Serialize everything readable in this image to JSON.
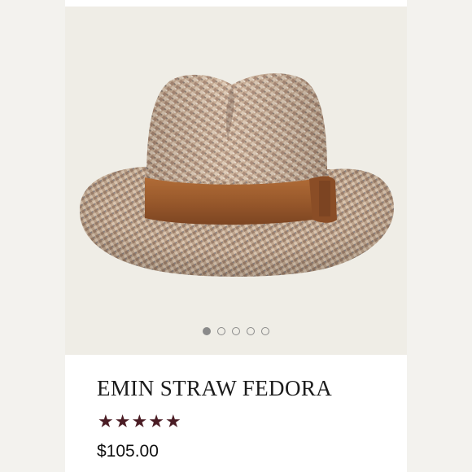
{
  "product": {
    "title": "EMIN STRAW FEDORA",
    "price": "$105.00",
    "rating": 5,
    "rating_max": 5,
    "star_glyph": "★",
    "image_icon": "straw-fedora-hat-image"
  },
  "gallery": {
    "image_count": 5,
    "active_index": 0
  },
  "colors": {
    "star": "#4a1c24",
    "band": "#9a5a2c",
    "background": "#efede6"
  }
}
